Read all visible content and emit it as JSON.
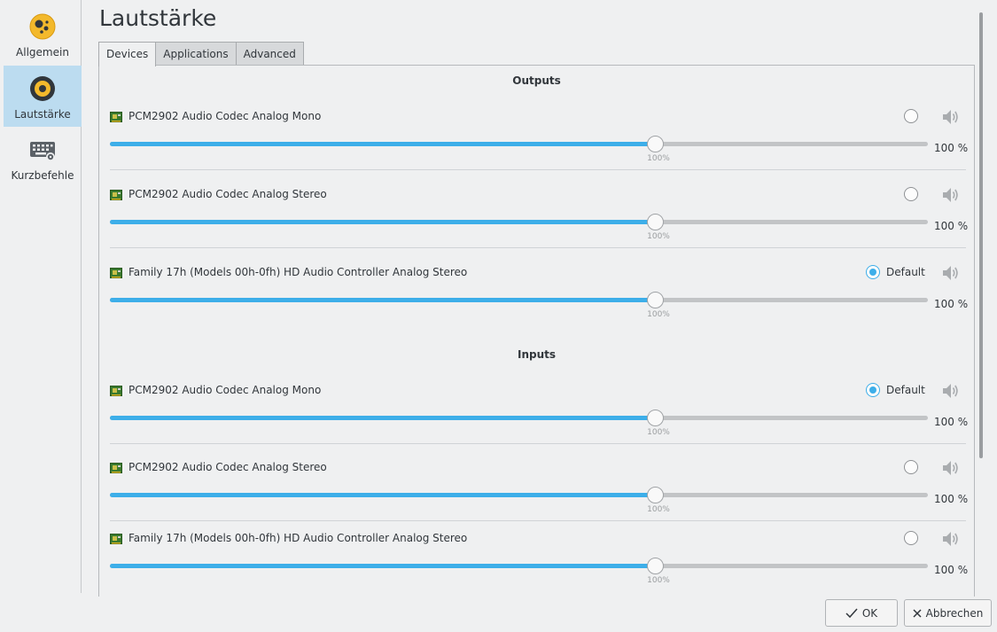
{
  "sidebar": {
    "items": [
      {
        "label": "Allgemein",
        "icon": "general-settings-icon",
        "active": false
      },
      {
        "label": "Lautstärke",
        "icon": "volume-icon",
        "active": true
      },
      {
        "label": "Kurzbefehle",
        "icon": "keyboard-icon",
        "active": false
      }
    ]
  },
  "page_title": "Lautstärke",
  "tabs": [
    "Devices",
    "Applications",
    "Advanced"
  ],
  "active_tab": "Devices",
  "outputs": {
    "title": "Outputs",
    "devices": [
      {
        "name": "PCM2902 Audio Codec Analog Mono",
        "default": false,
        "volume_percent": 100,
        "volume_text": "100 %",
        "tick_label": "100%"
      },
      {
        "name": "PCM2902 Audio Codec Analog Stereo",
        "default": false,
        "volume_percent": 100,
        "volume_text": "100 %",
        "tick_label": "100%"
      },
      {
        "name": "Family 17h (Models 00h-0fh) HD Audio Controller Analog Stereo",
        "default": true,
        "default_label": "Default",
        "volume_percent": 100,
        "volume_text": "100 %",
        "tick_label": "100%"
      }
    ]
  },
  "inputs": {
    "title": "Inputs",
    "devices": [
      {
        "name": "PCM2902 Audio Codec Analog Mono",
        "default": true,
        "default_label": "Default",
        "volume_percent": 100,
        "volume_text": "100 %",
        "tick_label": "100%"
      },
      {
        "name": "PCM2902 Audio Codec Analog Stereo",
        "default": false,
        "volume_percent": 100,
        "volume_text": "100 %",
        "tick_label": "100%"
      },
      {
        "name": "Family 17h (Models 00h-0fh) HD Audio Controller Analog Stereo",
        "default": false,
        "volume_percent": 100,
        "volume_text": "100 %",
        "tick_label": "100%"
      }
    ]
  },
  "buttons": {
    "ok": "OK",
    "cancel": "Abbrechen"
  },
  "colors": {
    "accent": "#3daee9",
    "sidebar_selected": "#bcdcf0"
  }
}
